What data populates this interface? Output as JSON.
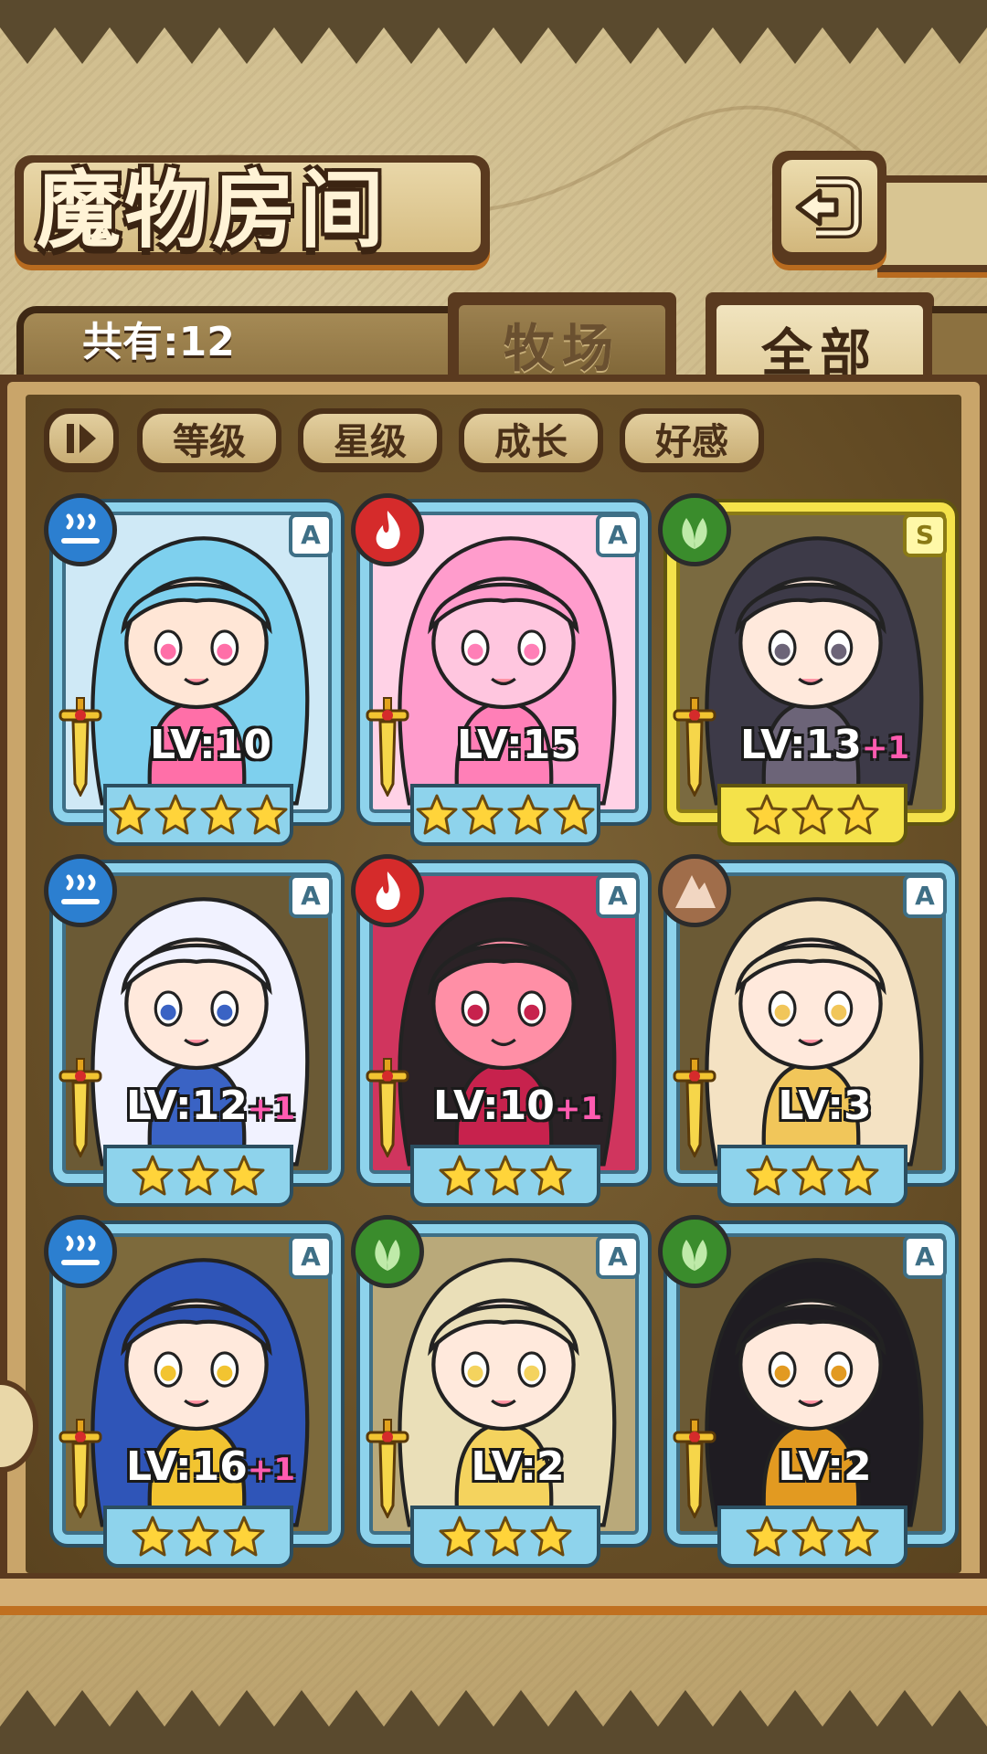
{
  "header": {
    "title": "魔物房间",
    "back_icon": "return-arrow-icon"
  },
  "summary": {
    "count_label": "共有:12"
  },
  "tabs": [
    {
      "label": "牧场",
      "selected": false
    },
    {
      "label": "全部",
      "selected": true
    }
  ],
  "sort": {
    "toggle_icon": "sort-toggle-icon",
    "buttons": [
      "等级",
      "星级",
      "成长",
      "好感"
    ]
  },
  "colors": {
    "frame_a": "#8ed3ec",
    "frame_s": "#f4e24a",
    "water": "#2c7fd0",
    "fire": "#d52b2b",
    "plant": "#3a8c2c",
    "earth": "#a06d4a",
    "bonus": "#ff5bb0"
  },
  "monsters": [
    {
      "element": "water",
      "rank": "A",
      "level": "LV:10",
      "bonus": "",
      "stars": 4,
      "hair": "#7ed0ee",
      "skin": "#ffe6d6",
      "accent": "#ff6fa8",
      "bg": "#cfe9f6"
    },
    {
      "element": "fire",
      "rank": "A",
      "level": "LV:15",
      "bonus": "",
      "stars": 4,
      "hair": "#ff9ccc",
      "skin": "#ffc6df",
      "accent": "#ff7fb7",
      "bg": "#ffd2e6"
    },
    {
      "element": "plant",
      "rank": "S",
      "level": "LV:13",
      "bonus": "+1",
      "stars": 3,
      "hair": "#3d3a48",
      "skin": "#ffe9dc",
      "accent": "#6c6478",
      "bg": "#7a6a40"
    },
    {
      "element": "water",
      "rank": "A",
      "level": "LV:12",
      "bonus": "+1",
      "stars": 3,
      "hair": "#f1f2ff",
      "skin": "#ffe9dc",
      "accent": "#3a63c4",
      "bg": "#6b5a35"
    },
    {
      "element": "fire",
      "rank": "A",
      "level": "LV:10",
      "bonus": "+1",
      "stars": 3,
      "hair": "#2b2226",
      "skin": "#ff8fa6",
      "accent": "#c7224d",
      "bg": "#d0355e"
    },
    {
      "element": "earth",
      "rank": "A",
      "level": "LV:3",
      "bonus": "",
      "stars": 3,
      "hair": "#f4e2c3",
      "skin": "#ffe9dc",
      "accent": "#f1c65a",
      "bg": "#6b5a35"
    },
    {
      "element": "water",
      "rank": "A",
      "level": "LV:16",
      "bonus": "+1",
      "stars": 3,
      "hair": "#2f55b8",
      "skin": "#ffe9dc",
      "accent": "#f2c431",
      "bg": "#7d6a3c"
    },
    {
      "element": "plant",
      "rank": "A",
      "level": "LV:2",
      "bonus": "",
      "stars": 3,
      "hair": "#eadfb8",
      "skin": "#ffe9dc",
      "accent": "#f4d35e",
      "bg": "#b9a97a"
    },
    {
      "element": "plant",
      "rank": "A",
      "level": "LV:2",
      "bonus": "",
      "stars": 3,
      "hair": "#1f1c22",
      "skin": "#ffe9dc",
      "accent": "#e29a21",
      "bg": "#6b5a35"
    }
  ]
}
